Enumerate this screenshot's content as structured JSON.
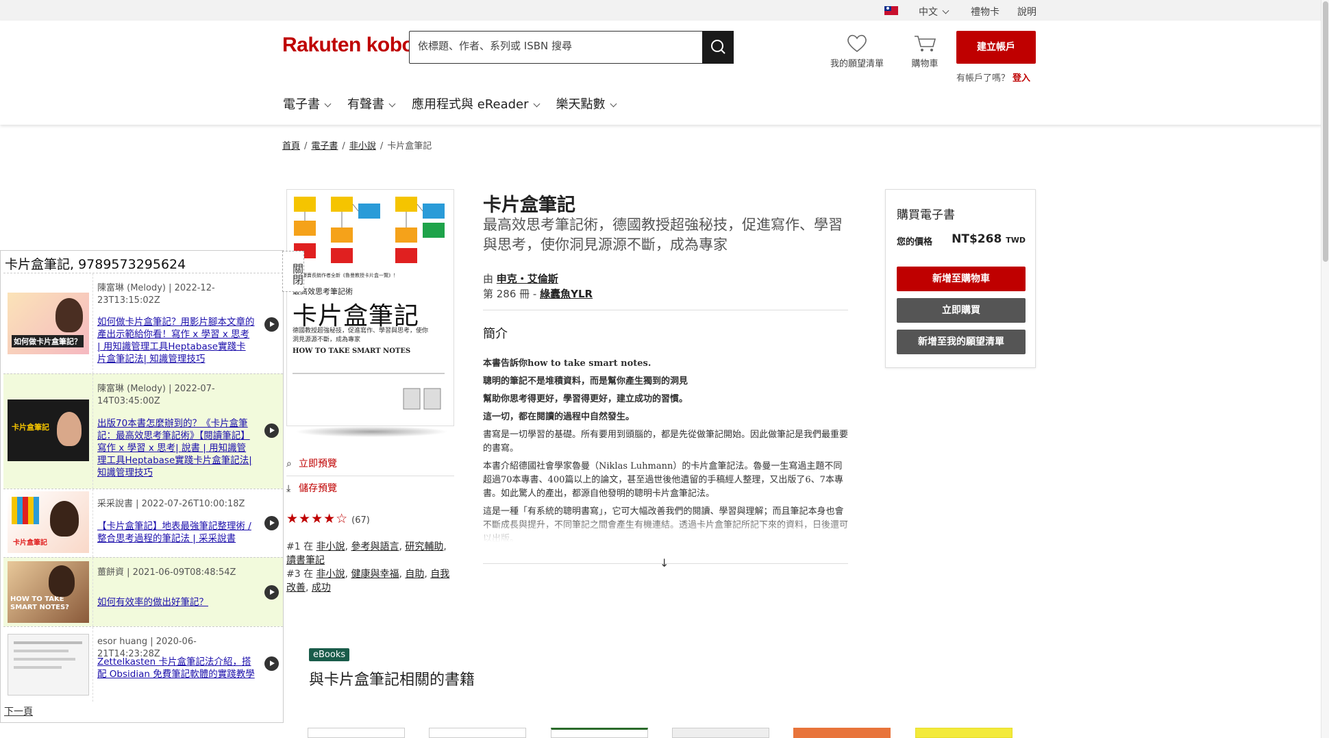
{
  "utility_bar": {
    "language": "中文",
    "gift_card": "禮物卡",
    "help": "說明"
  },
  "header": {
    "logo_rakuten": "Rakuten",
    "logo_kobo": "kobo",
    "search_placeholder": "依標題、作者、系列或 ISBN 搜尋",
    "wishlist_label": "我的願望清單",
    "cart_label": "購物車",
    "create_account": "建立帳戶",
    "have_account": "有帳戶了嗎？",
    "login": "登入"
  },
  "nav": [
    "電子書",
    "有聲書",
    "應用程式與 eReader",
    "樂天點數"
  ],
  "breadcrumb": [
    "首頁",
    "電子書",
    "非小說",
    "卡片盒筆記"
  ],
  "book": {
    "title": "卡片盒筆記",
    "subtitle": "最高效思考筆記術，德國教授超強秘技，促進寫作、學習與思考，使你洞見源源不斷，成為專家",
    "by": "由",
    "author": "申克・艾倫斯",
    "series_prefix": "第 286 冊 -",
    "series": "綠蠹魚YLR",
    "cover_title": "卡片盒筆記",
    "cover_sub": "最高效思考筆記術",
    "cover_en": "HOW TO TAKE SMART NOTES",
    "cover_desc": "德國教授超強秘技，促進寫作、學習與思考，使你洞見源源不斷，成為專家",
    "cover_top": "全球爆賣長銷作者全新《魯曼教授卡片盒一覽》！"
  },
  "preview": {
    "preview_now": "立即預覽",
    "save_preview": "儲存預覽"
  },
  "rating": {
    "stars": 4.5,
    "count": "(67)"
  },
  "ranks": {
    "r1_prefix": "#1 在",
    "r1_links": [
      "非小說",
      "參考與語言",
      "研究輔助",
      "讀書筆記"
    ],
    "r3_prefix": "#3 在",
    "r3_links": [
      "非小說",
      "健康與幸福",
      "自助",
      "自我改善",
      "成功"
    ]
  },
  "intro": {
    "heading": "簡介",
    "paragraphs": [
      "本書告訴你how to take smart notes.",
      "聰明的筆記不是堆積資料，而是幫你產生獨到的洞見",
      "幫助你思考得更好，學習得更好，建立成功的習慣。",
      "這一切，都在閱讀的過程中自然發生。",
      "書寫是一切學習的基礎。所有要用到頭腦的，都是先從做筆記開始。因此做筆記是我們最重要的書寫。",
      "本書介紹德國社會學家魯曼（Niklas Luhmann）的卡片盒筆記法。魯曼一生寫過主題不同超過70本專書、400篇以上的論文，甚至過世後他遺留的手稿經人整理，又出版了6、7本專書。如此驚人的產出，都源自他發明的聰明卡片盒筆記法。",
      "這是一種「有系統的聰明書寫」，它可大幅改善我們的閱讀、學習與理解；而且筆記本身也會不斷成長與提升，不同筆記之間會產生有機連結。透過卡片盒筆記所記下來的資料，日後還可以出版。"
    ]
  },
  "buybox": {
    "heading": "購買電子書",
    "price_label": "您的價格",
    "price": "NT$268",
    "currency": "TWD",
    "add_to_cart": "新增至購物車",
    "buy_now": "立即購買",
    "add_wishlist": "新增至我的願望清單",
    "colors": {
      "primary": "#bf0000",
      "secondary": "#555555"
    }
  },
  "related": {
    "badge": "eBooks",
    "heading": "與卡片盒筆記相關的書籍"
  },
  "panel": {
    "title": "卡片盒筆記, 9789573295624",
    "close_label": "關閉",
    "next_page": "下一頁",
    "videos": [
      {
        "meta": "陳富琳 (Melody) | 2022-12-23T13:15:02Z",
        "title": "如何做卡片盒筆記？用影片腳本文章的產出示範給你看！寫作 x 學習 x 思考 | 用知識管理工具Heptabase實踐卡片盒筆記法| 知識管理技巧",
        "thumb_text": "如何做卡片盒筆記？"
      },
      {
        "meta": "陳富琳 (Melody) | 2022-07-14T03:45:00Z",
        "title": "出版70本書怎麼辦到的？《卡片盒筆記：最高效思考筆記術》【閱讀筆記】寫作 x 學習 x 思考| 說書 | 用知識管理工具Heptabase實踐卡片盒筆記法| 知識管理技巧",
        "thumb_text": "卡片盒筆記"
      },
      {
        "meta": "采采說書 | 2022-07-26T10:00:18Z",
        "title": "【卡片盒筆記】地表最強筆記整理術 / 整合思考過程的筆記法 | 采采說書",
        "thumb_text": "卡片盒筆記"
      },
      {
        "meta": "薑餅資 | 2021-06-09T08:48:54Z",
        "title": "如何有效率的做出好筆記？",
        "thumb_text": "HOW TO TAKE SMART NOTES?"
      },
      {
        "meta": "esor huang | 2020-06-21T14:23:28Z",
        "title": "Zettelkasten 卡片盒筆記法介紹，搭配 Obsidian 免費筆記軟體的實踐教學",
        "thumb_text": ""
      }
    ]
  }
}
